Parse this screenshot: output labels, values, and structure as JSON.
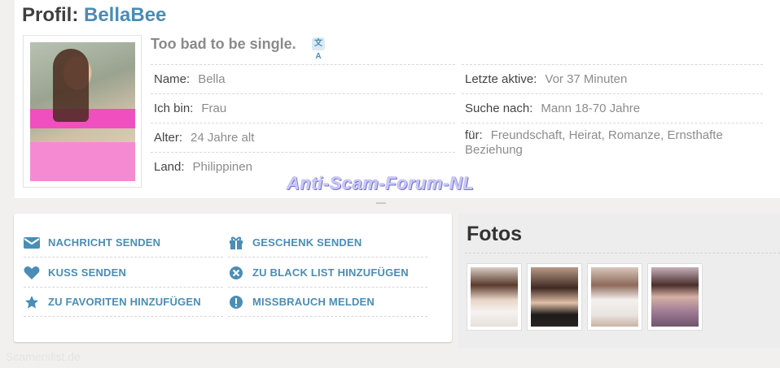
{
  "profile": {
    "title_prefix": "Profil:",
    "username": "BellaBee",
    "tagline": "Too bad to be single.",
    "translate_icon": "translate-icon"
  },
  "details": {
    "left": [
      {
        "label": "Name:",
        "value": "Bella"
      },
      {
        "label": "Ich bin:",
        "value": "Frau"
      },
      {
        "label": "Alter:",
        "value": "24 Jahre alt"
      },
      {
        "label": "Land:",
        "value": "Philippinen"
      }
    ],
    "right": [
      {
        "label": "Letzte aktive:",
        "value": "Vor 37 Minuten"
      },
      {
        "label": "Suche nach:",
        "value": "Mann 18-70 Jahre"
      },
      {
        "label": "für:",
        "value": "Freundschaft, Heirat, Romanze, Ernsthafte Beziehung"
      }
    ]
  },
  "watermark": "Anti-Scam-Forum-NL",
  "actions": [
    {
      "label": "NACHRICHT SENDEN",
      "icon": "envelope-icon"
    },
    {
      "label": "GESCHENK SENDEN",
      "icon": "gift-icon"
    },
    {
      "label": "KUSS SENDEN",
      "icon": "heart-icon"
    },
    {
      "label": "ZU BLACK LIST HINZUFÜGEN",
      "icon": "block-icon"
    },
    {
      "label": "ZU FAVORITEN HINZUFÜGEN",
      "icon": "star-icon"
    },
    {
      "label": "MISSBRAUCH MELDEN",
      "icon": "alert-icon"
    }
  ],
  "fotos": {
    "title": "Fotos",
    "count": 4
  },
  "footer_watermark": "Scamerslist.de",
  "colors": {
    "accent": "#4a8db6",
    "background": "#f1f0ef"
  }
}
